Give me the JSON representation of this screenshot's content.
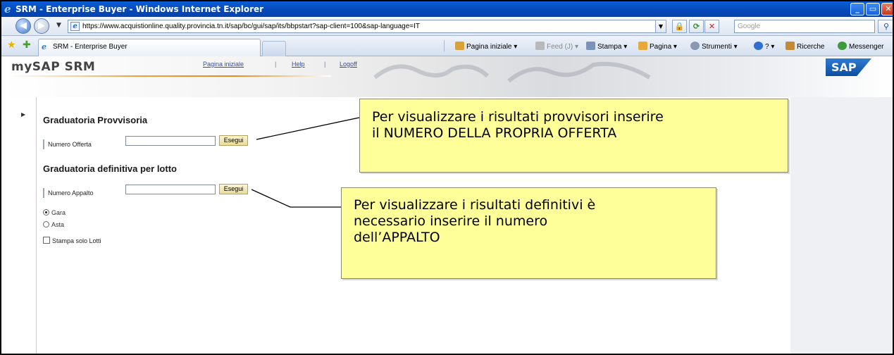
{
  "window": {
    "title": "SRM - Enterprise Buyer - Windows Internet Explorer",
    "controls": [
      "minimize",
      "maximize",
      "close"
    ]
  },
  "address_bar": {
    "url": "https://www.acquistionline.quality.provincia.tn.it/sap/bc/gui/sap/its/bbpstart?sap-client=100&sap-language=IT",
    "search_placeholder": "Google"
  },
  "tab": {
    "label": "SRM - Enterprise Buyer"
  },
  "command_bar": {
    "home": "Pagina iniziale",
    "feeds": "Feed (J)",
    "print": "Stampa",
    "page": "Pagina",
    "tools": "Strumenti",
    "help": "?",
    "research": "Ricerche",
    "messenger": "Messenger"
  },
  "sap_header": {
    "brand": "mySAP SRM",
    "links": [
      "Pagina iniziale",
      "Help",
      "Logoff"
    ],
    "logo": "SAP"
  },
  "form": {
    "section1_title": "Graduatoria Provvisoria",
    "offer_label": "Numero Offerta",
    "offer_value": "",
    "execute_label": "Esegui",
    "section2_title": "Graduatoria definitiva per lotto",
    "contract_label": "Numero Appalto",
    "contract_value": "",
    "radio_options": [
      "Gara",
      "Asta"
    ],
    "radio_selected": "Gara",
    "checkbox_label": "Stampa solo Lotti",
    "checkbox_checked": false
  },
  "callouts": {
    "provisional": [
      "Per visualizzare i risultati provvisori inserire",
      "il NUMERO DELLA PROPRIA OFFERTA"
    ],
    "definitive": [
      "Per visualizzare i risultati definitivi è",
      "necessario inserire il numero",
      "dell’APPALTO"
    ]
  },
  "colors": {
    "titlebar": "#0447b8",
    "callout_fill": "#ffff99",
    "button_fill": "#e9dc9a",
    "link": "#3050b0"
  }
}
